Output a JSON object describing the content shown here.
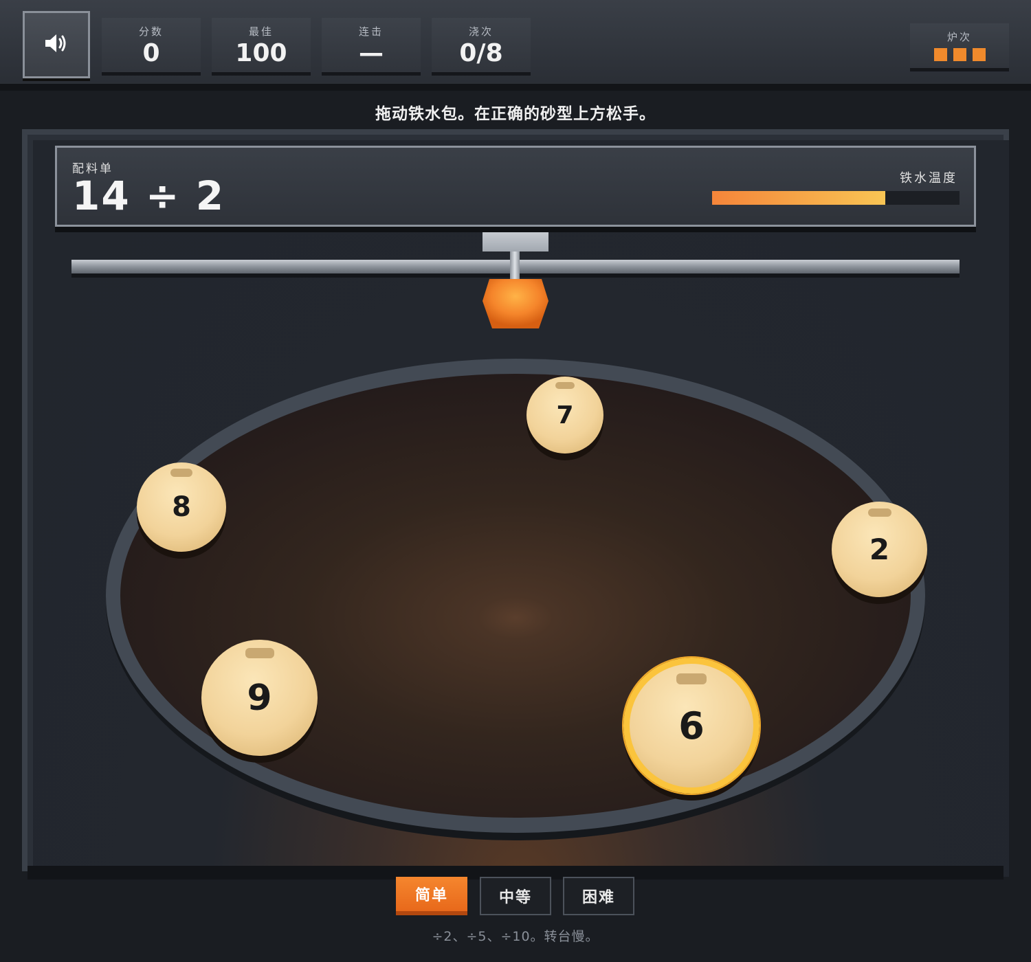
{
  "hud": {
    "sound_icon": "speaker-icon",
    "stats": [
      {
        "label": "分数",
        "value": "0"
      },
      {
        "label": "最佳",
        "value": "100"
      },
      {
        "label": "连击",
        "value": "—"
      },
      {
        "label": "浇次",
        "value": "0/8"
      }
    ],
    "furnace": {
      "label": "炉次",
      "lives": 3
    }
  },
  "instruction": "拖动铁水包。在正确的砂型上方松手。",
  "order": {
    "label": "配料单",
    "equation": "14 ÷ 2",
    "temperature_label": "铁水温度",
    "temperature_level": 0.7
  },
  "molds": [
    {
      "value": "7"
    },
    {
      "value": "8"
    },
    {
      "value": "2"
    },
    {
      "value": "9"
    },
    {
      "value": "6",
      "highlighted": true
    }
  ],
  "difficulty": {
    "options": [
      "简单",
      "中等",
      "困难"
    ],
    "selected": "简单",
    "hint": "÷2、÷5、÷10。转台慢。"
  },
  "colors": {
    "accent": "#f08a2c",
    "highlight": "#fbc43c",
    "mold": "#f2d39a"
  }
}
